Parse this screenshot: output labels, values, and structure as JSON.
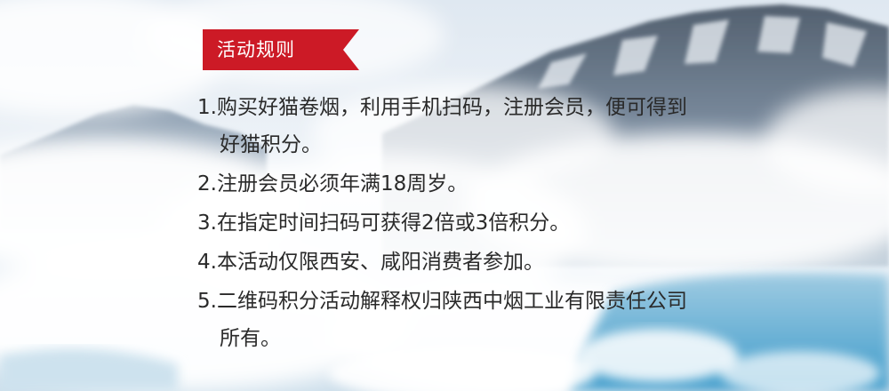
{
  "tag": {
    "label": "活动规则",
    "color": "#cc1a26"
  },
  "rules": [
    "1.购买好猫卷烟，利用手机扫码，注册会员，便可得到好猫积分。",
    "2.注册会员必须年满18周岁。",
    "3.在指定时间扫码可获得2倍或3倍积分。",
    "4.本活动仅限西安、咸阳消费者参加。",
    "5.二维码积分活动解释权归陕西中烟工业有限责任公司所有。"
  ],
  "colors": {
    "text": "#2a2a2a",
    "sky": "#eef3f8",
    "mountain": "#5a6b80",
    "cloud": "#ffffff",
    "water": "#4fa6cf"
  }
}
